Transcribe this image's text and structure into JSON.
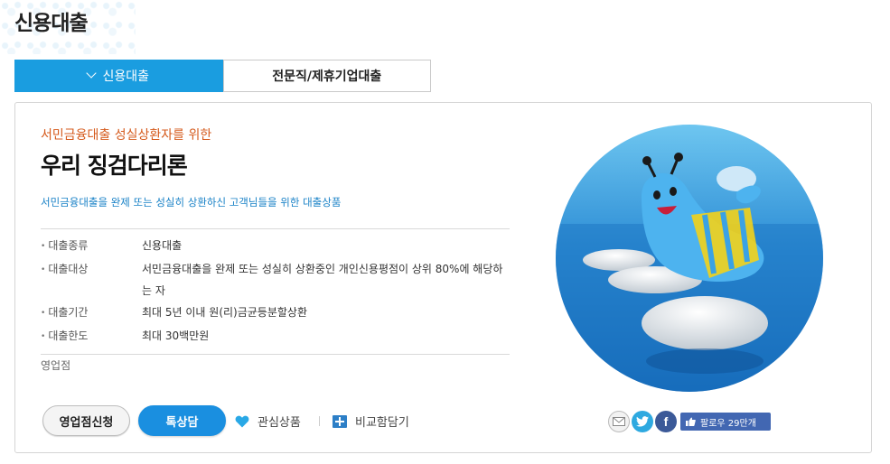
{
  "page": {
    "title": "신용대출"
  },
  "tabs": [
    {
      "label": "신용대출",
      "active": true
    },
    {
      "label": "전문직/제휴기업대출",
      "active": false
    }
  ],
  "product": {
    "subtitle": "서민금융대출 성실상환자를 위한",
    "title": "우리 징검다리론",
    "description": "서민금융대출을 완제 또는 성실히 상환하신 고객님들을 위한 대출상품",
    "info": [
      {
        "key": "대출종류",
        "value": "신용대출"
      },
      {
        "key": "대출대상",
        "value": "서민금융대출을 완제 또는 성실히 상환중인 개인신용평점이 상위 80%에 해당하는 자"
      },
      {
        "key": "대출기간",
        "value": "최대 5년 이내 원(리)금균등분할상환"
      },
      {
        "key": "대출한도",
        "value": "최대 30백만원"
      }
    ],
    "branch_label": "영업점"
  },
  "actions": {
    "apply_label": "영업점신청",
    "quick_label": "톡상담",
    "favorite_label": "관심상품",
    "compare_label": "비교함담기"
  },
  "social": {
    "follow_label": "팔로우 29만개"
  },
  "colors": {
    "accent": "#1a9de0",
    "subtitle": "#d55a1c",
    "description": "#1a82c7",
    "facebook": "#4267b2"
  }
}
